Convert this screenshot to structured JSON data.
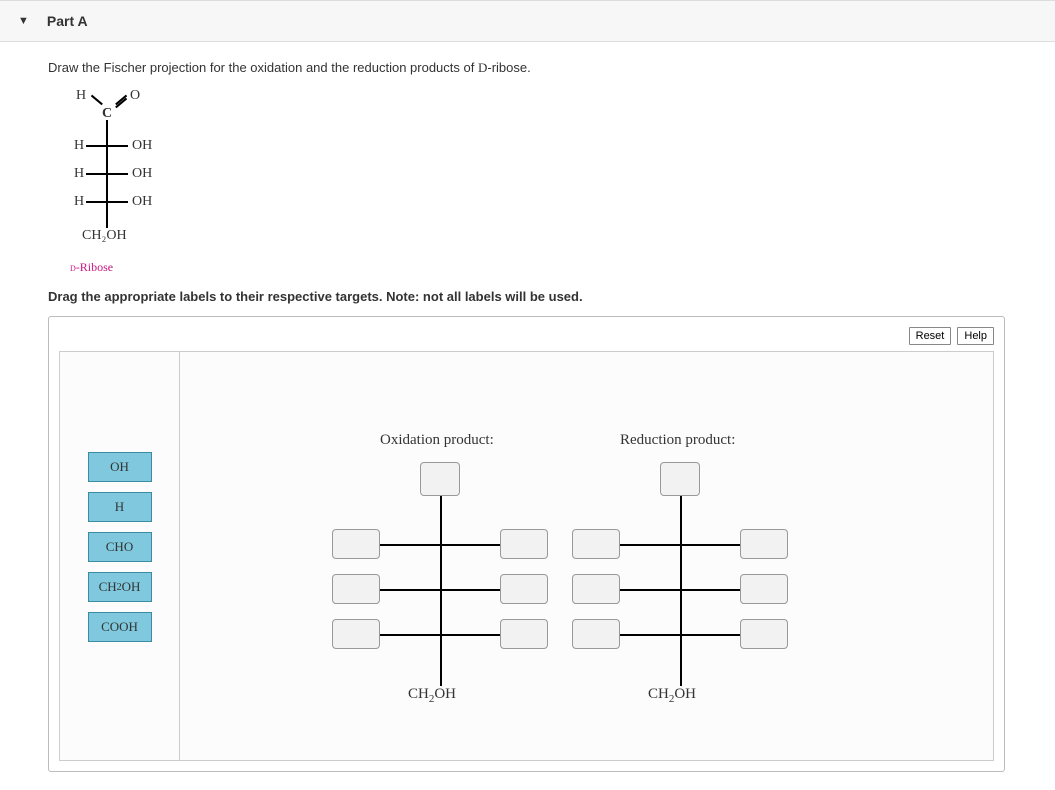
{
  "part": {
    "title": "Part A"
  },
  "prompt": "Draw the Fischer projection for the oxidation and the reduction products of D-ribose.",
  "fischer": {
    "top_h": "H",
    "top_o": "O",
    "top_c": "C",
    "rows": [
      {
        "left": "H",
        "right": "OH"
      },
      {
        "left": "H",
        "right": "OH"
      },
      {
        "left": "H",
        "right": "OH"
      }
    ],
    "bottom": "CH₂OH",
    "compound_label": "D-Ribose"
  },
  "instruction": "Drag the appropriate labels to their respective targets. Note: not all labels will be used.",
  "buttons": {
    "reset": "Reset",
    "help": "Help"
  },
  "labels": [
    "OH",
    "H",
    "CHO",
    "CH₂OH",
    "COOH"
  ],
  "products": {
    "oxidation": {
      "title": "Oxidation product:",
      "bottom": "CH₂OH"
    },
    "reduction": {
      "title": "Reduction product:",
      "bottom": "CH₂OH"
    }
  }
}
